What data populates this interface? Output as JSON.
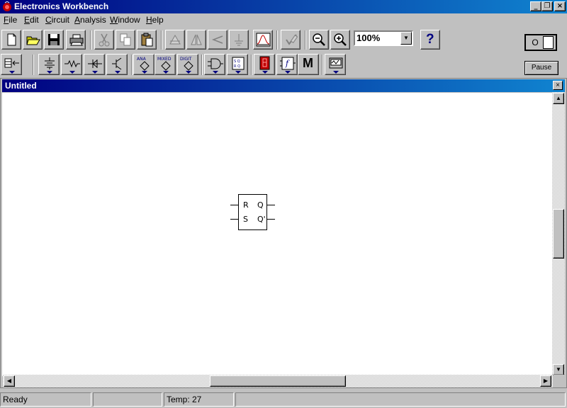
{
  "window": {
    "title": "Electronics Workbench",
    "minimize": "_",
    "restore": "❐",
    "close": "×"
  },
  "menu": [
    {
      "underline": "F",
      "rest": "ile"
    },
    {
      "underline": "E",
      "rest": "dit"
    },
    {
      "underline": "C",
      "rest": "ircuit"
    },
    {
      "underline": "A",
      "rest": "nalysis"
    },
    {
      "underline": "W",
      "rest": "indow"
    },
    {
      "underline": "H",
      "rest": "elp"
    }
  ],
  "toolbar": {
    "zoom_value": "100%",
    "help_label": "?",
    "pause_label": "Pause",
    "power_label": "O",
    "bins": {
      "ana": "ANA",
      "mixed": "MIXED",
      "digit": "DIGIT",
      "misc": "M"
    }
  },
  "document": {
    "title": "Untitled",
    "close": "×"
  },
  "component": {
    "name": "RS flip-flop",
    "pins": {
      "r": "R",
      "s": "S",
      "q": "Q",
      "qbar": "Q'"
    }
  },
  "status": {
    "ready": "Ready",
    "empty": "",
    "temp": "Temp:  27"
  },
  "colors": {
    "titlebar_start": "#000080",
    "titlebar_end": "#1084d0",
    "face": "#c0c0c0"
  }
}
